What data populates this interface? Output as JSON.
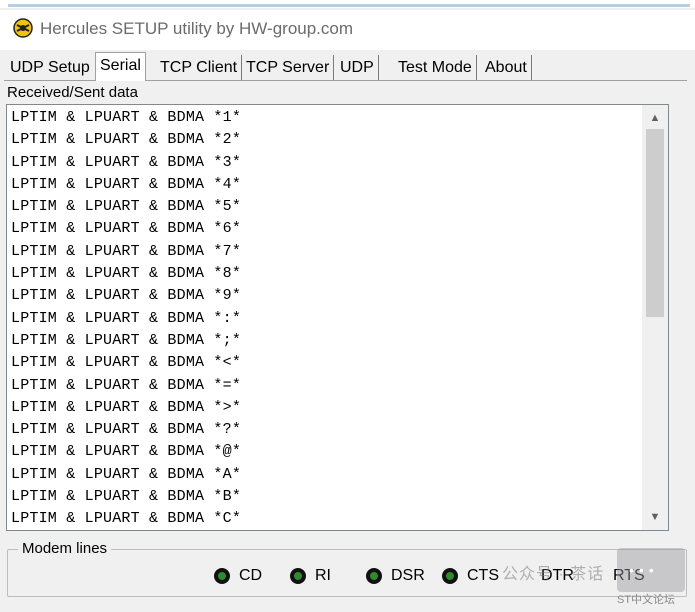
{
  "window": {
    "title": "Hercules SETUP utility by HW-group.com"
  },
  "tabs": [
    {
      "label": "UDP Setup",
      "active": false
    },
    {
      "label": "Serial",
      "active": true
    },
    {
      "label": "TCP Client",
      "active": false
    },
    {
      "label": "TCP Server",
      "active": false
    },
    {
      "label": "UDP",
      "active": false
    },
    {
      "label": "Test Mode",
      "active": false
    },
    {
      "label": "About",
      "active": false
    }
  ],
  "received_sent": {
    "label": "Received/Sent data",
    "lines": [
      "LPTIM & LPUART & BDMA *1*",
      "LPTIM & LPUART & BDMA *2*",
      "LPTIM & LPUART & BDMA *3*",
      "LPTIM & LPUART & BDMA *4*",
      "LPTIM & LPUART & BDMA *5*",
      "LPTIM & LPUART & BDMA *6*",
      "LPTIM & LPUART & BDMA *7*",
      "LPTIM & LPUART & BDMA *8*",
      "LPTIM & LPUART & BDMA *9*",
      "LPTIM & LPUART & BDMA *:*",
      "LPTIM & LPUART & BDMA *;*",
      "LPTIM & LPUART & BDMA *<*",
      "LPTIM & LPUART & BDMA *=*",
      "LPTIM & LPUART & BDMA *>*",
      "LPTIM & LPUART & BDMA *?*",
      "LPTIM & LPUART & BDMA *@*",
      "LPTIM & LPUART & BDMA *A*",
      "LPTIM & LPUART & BDMA *B*",
      "LPTIM & LPUART & BDMA *C*"
    ]
  },
  "scrollbar": {
    "up_icon": "▲",
    "down_icon": "▼"
  },
  "modem_lines": {
    "title": "Modem lines",
    "indicators": [
      {
        "label": "CD"
      },
      {
        "label": "RI"
      },
      {
        "label": "DSR"
      },
      {
        "label": "CTS"
      },
      {
        "label": "DTR"
      },
      {
        "label": "RTS"
      }
    ]
  },
  "watermark": {
    "text": "公众号 · 茶话",
    "site": "ST中文论坛"
  },
  "colors": {
    "led_on": "#2e8b2e",
    "title_text": "#6b6b6b"
  }
}
